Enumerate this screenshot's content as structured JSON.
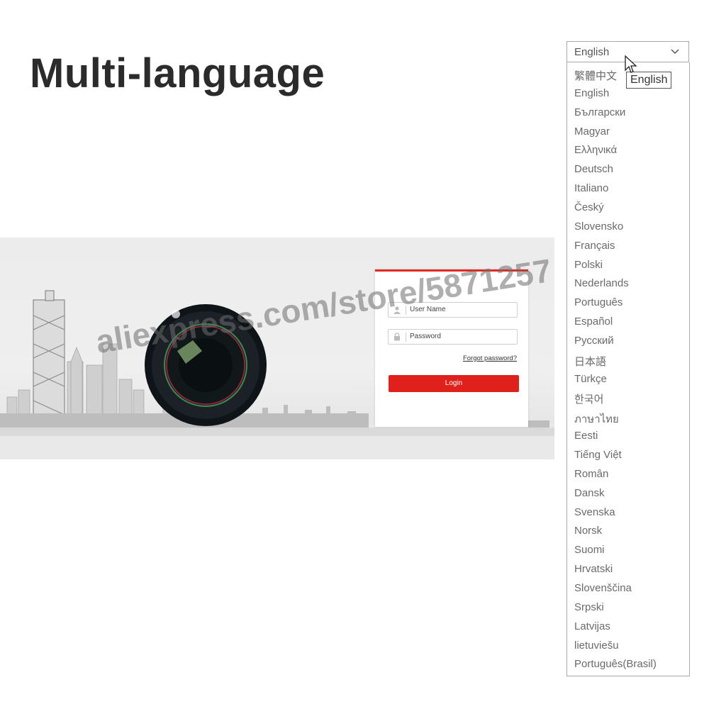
{
  "page_title": "Multi-language",
  "login": {
    "username_placeholder": "User Name",
    "password_placeholder": "Password",
    "forgot_label": "Forgot password?",
    "login_label": "Login",
    "accent_color": "#e0201a"
  },
  "watermark": "aliexpress.com/store/5871257",
  "language_select": {
    "selected": "English",
    "tooltip": "English",
    "options": [
      "繁體中文",
      "English",
      "Български",
      "Magyar",
      "Ελληνικά",
      "Deutsch",
      "Italiano",
      "Český",
      "Slovensko",
      "Français",
      "Polski",
      "Nederlands",
      "Português",
      "Español",
      "Русский",
      "日本語",
      "Türkçe",
      "한국어",
      "ภาษาไทย",
      "Eesti",
      "Tiếng Việt",
      "Român",
      "Dansk",
      "Svenska",
      "Norsk",
      "Suomi",
      "Hrvatski",
      "Slovenščina",
      "Srpski",
      "Latvijas",
      "lietuviešu",
      "Português(Brasil)"
    ]
  }
}
